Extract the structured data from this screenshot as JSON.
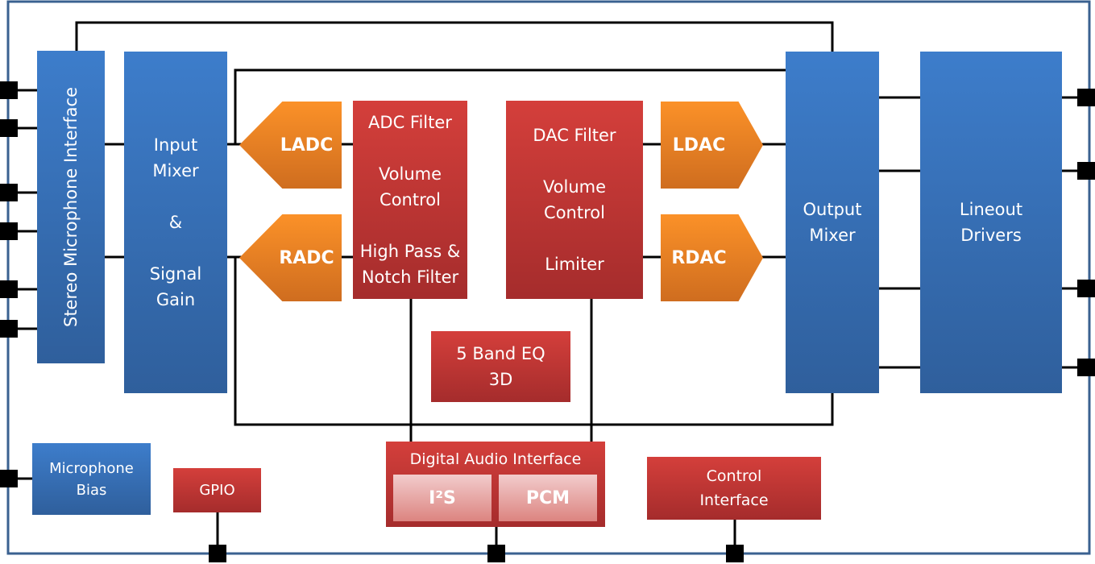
{
  "colors": {
    "block_blue": "#3a77c4",
    "block_red": "#c83a36",
    "converter_orange": "#f08a25",
    "border": "#3a6190",
    "wire": "#000000"
  },
  "blocks": {
    "stereo_mic": "Stereo Microphone Interface",
    "input_mixer": "Input\nMixer\n\n&\n\nSignal\nGain",
    "ladc": "LADC",
    "radc": "RADC",
    "adc_filter": "ADC Filter\n\nVolume\nControl\n\nHigh Pass &\nNotch Filter",
    "dac_filter": "DAC Filter\n\nVolume\nControl\n\nLimiter",
    "ldac": "LDAC",
    "rdac": "RDAC",
    "output_mixer": "Output\nMixer",
    "lineout": "Lineout\nDrivers",
    "eq": "5 Band EQ\n3D",
    "mic_bias": "Microphone\nBias",
    "gpio": "GPIO",
    "dai": "Digital Audio Interface",
    "i2s": "I²S",
    "pcm": "PCM",
    "control": "Control\nInterface"
  }
}
